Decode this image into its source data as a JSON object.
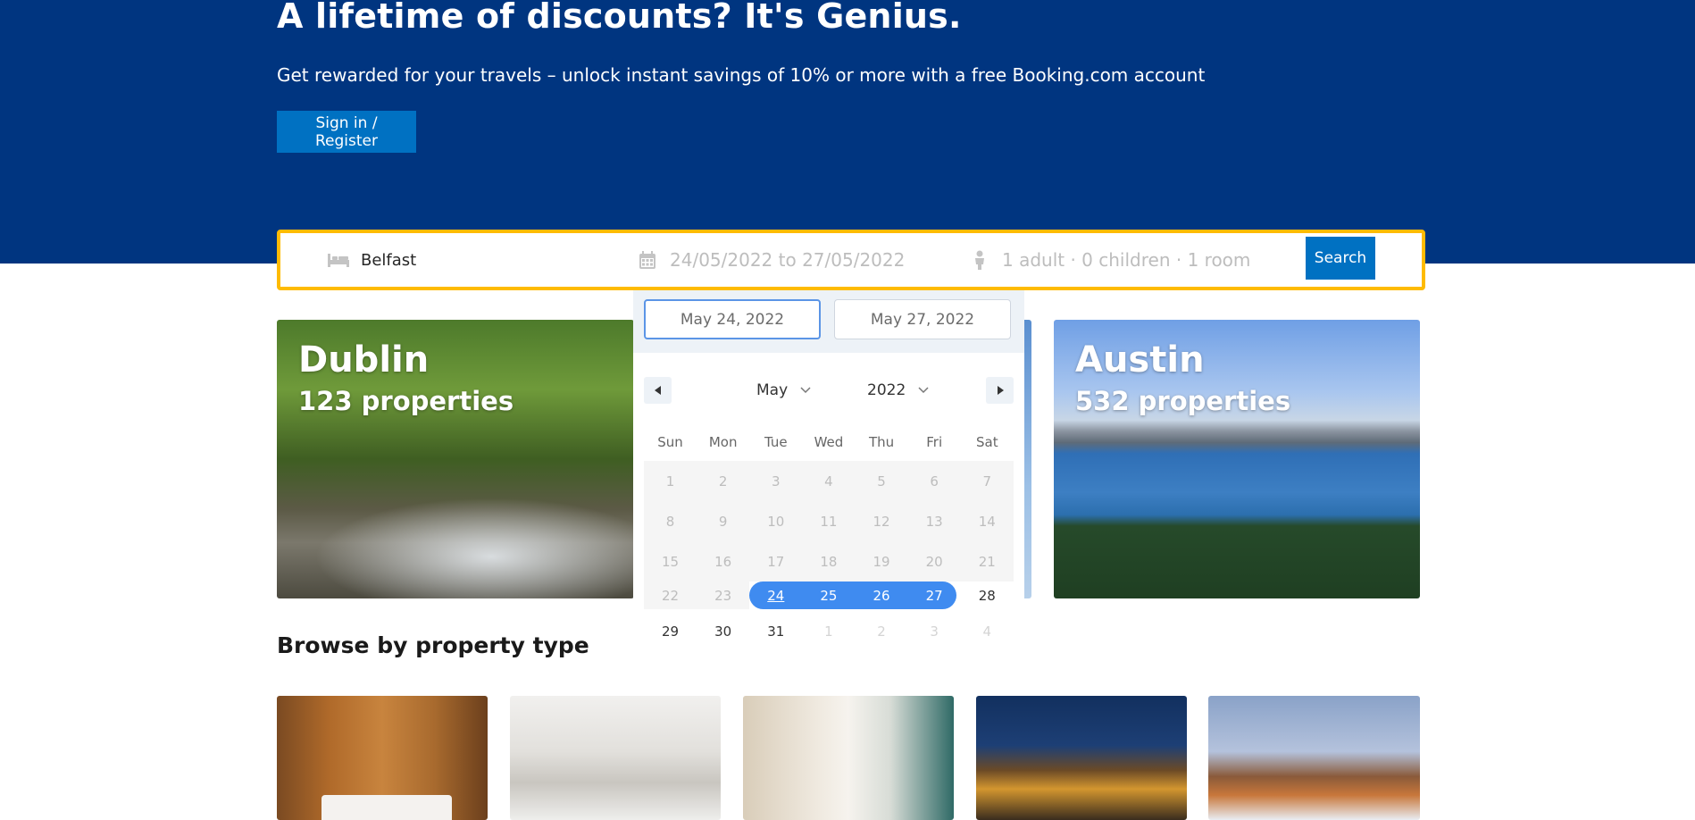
{
  "hero": {
    "title": "A lifetime of discounts? It's Genius.",
    "subtitle": "Get rewarded for your travels – unlock instant savings of 10% or more with a free Booking.com account",
    "signin_label": "Sign in / Register",
    "background_color": "#003580"
  },
  "search": {
    "destination": "Belfast",
    "dates": "24/05/2022 to 27/05/2022",
    "guests": "1 adult · 0 children · 1 room",
    "search_label": "Search",
    "border_color": "#febb02",
    "icons": {
      "destination": "bed-icon",
      "dates": "calendar-icon",
      "guests": "person-icon"
    }
  },
  "datepicker": {
    "start_value": "May 24, 2022",
    "end_value": "May 27, 2022",
    "month": "May",
    "year": "2022",
    "weekdays": [
      "Sun",
      "Mon",
      "Tue",
      "Wed",
      "Thu",
      "Fri",
      "Sat"
    ],
    "weeks": [
      [
        "1",
        "2",
        "3",
        "4",
        "5",
        "6",
        "7"
      ],
      [
        "8",
        "9",
        "10",
        "11",
        "12",
        "13",
        "14"
      ],
      [
        "15",
        "16",
        "17",
        "18",
        "19",
        "20",
        "21"
      ],
      [
        "22",
        "23",
        "24",
        "25",
        "26",
        "27",
        "28"
      ],
      [
        "29",
        "30",
        "31",
        "1",
        "2",
        "3",
        "4"
      ]
    ],
    "selected_range": [
      "24",
      "25",
      "26",
      "27"
    ],
    "range_color": "#3f8bf0"
  },
  "cities": [
    {
      "name": "Dublin",
      "count": "123 properties"
    },
    {
      "name": "Austin",
      "count": "532 properties"
    }
  ],
  "browse": {
    "title": "Browse by property type"
  }
}
